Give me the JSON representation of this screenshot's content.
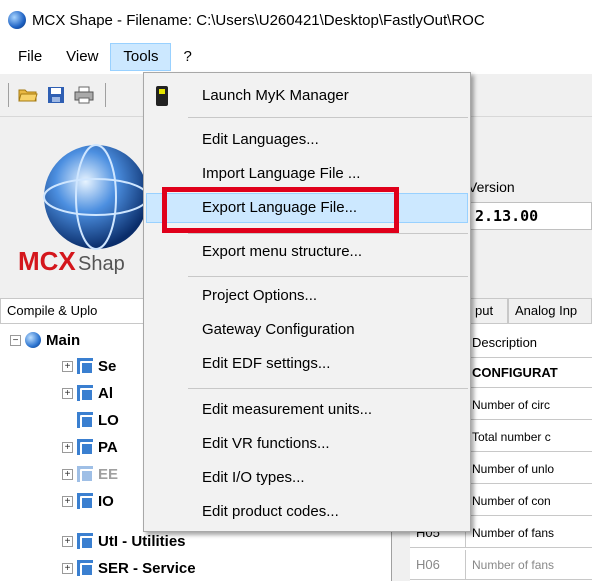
{
  "window": {
    "title": "MCX Shape  -  Filename: C:\\Users\\U260421\\Desktop\\FastlyOut\\ROC"
  },
  "menubar": {
    "items": [
      "File",
      "View",
      "Tools",
      "?"
    ]
  },
  "tools_menu": {
    "items": [
      "Launch MyK Manager",
      "Edit Languages...",
      "Import Language File ...",
      "Export Language File...",
      "Export menu structure...",
      "Project Options...",
      "Gateway Configuration",
      "Edit EDF settings...",
      "Edit measurement units...",
      "Edit VR functions...",
      "Edit I/O types...",
      "Edit product codes..."
    ],
    "highlighted": "Export Language File..."
  },
  "info_panel": {
    "logo_text": "MCXShape",
    "version_label": "Version",
    "version_value": "2.13.00"
  },
  "tabs": [
    "Compile & Uplo",
    "put",
    "Analog Inp"
  ],
  "tree": {
    "root": "Main",
    "nodes": [
      "Se",
      "Al",
      "LO",
      "PA",
      "EE",
      "IO",
      "UtI - Utilities",
      "SER - Service"
    ]
  },
  "grid": {
    "header": "Description",
    "section_label": "CONFIGURAT",
    "rows": [
      {
        "code": "",
        "desc": "Number of circ"
      },
      {
        "code": "",
        "desc": "Total number c"
      },
      {
        "code": "",
        "desc": "Number of unlo"
      },
      {
        "code": "",
        "desc": "Number of con"
      },
      {
        "code": "H05",
        "desc": "Number of fans"
      },
      {
        "code": "H06",
        "desc": "Number of fans"
      }
    ]
  },
  "colors": {
    "menu_highlight": "#cce8ff",
    "annotation_red": "#e0001b",
    "section_blue": "#1e6fd9"
  }
}
